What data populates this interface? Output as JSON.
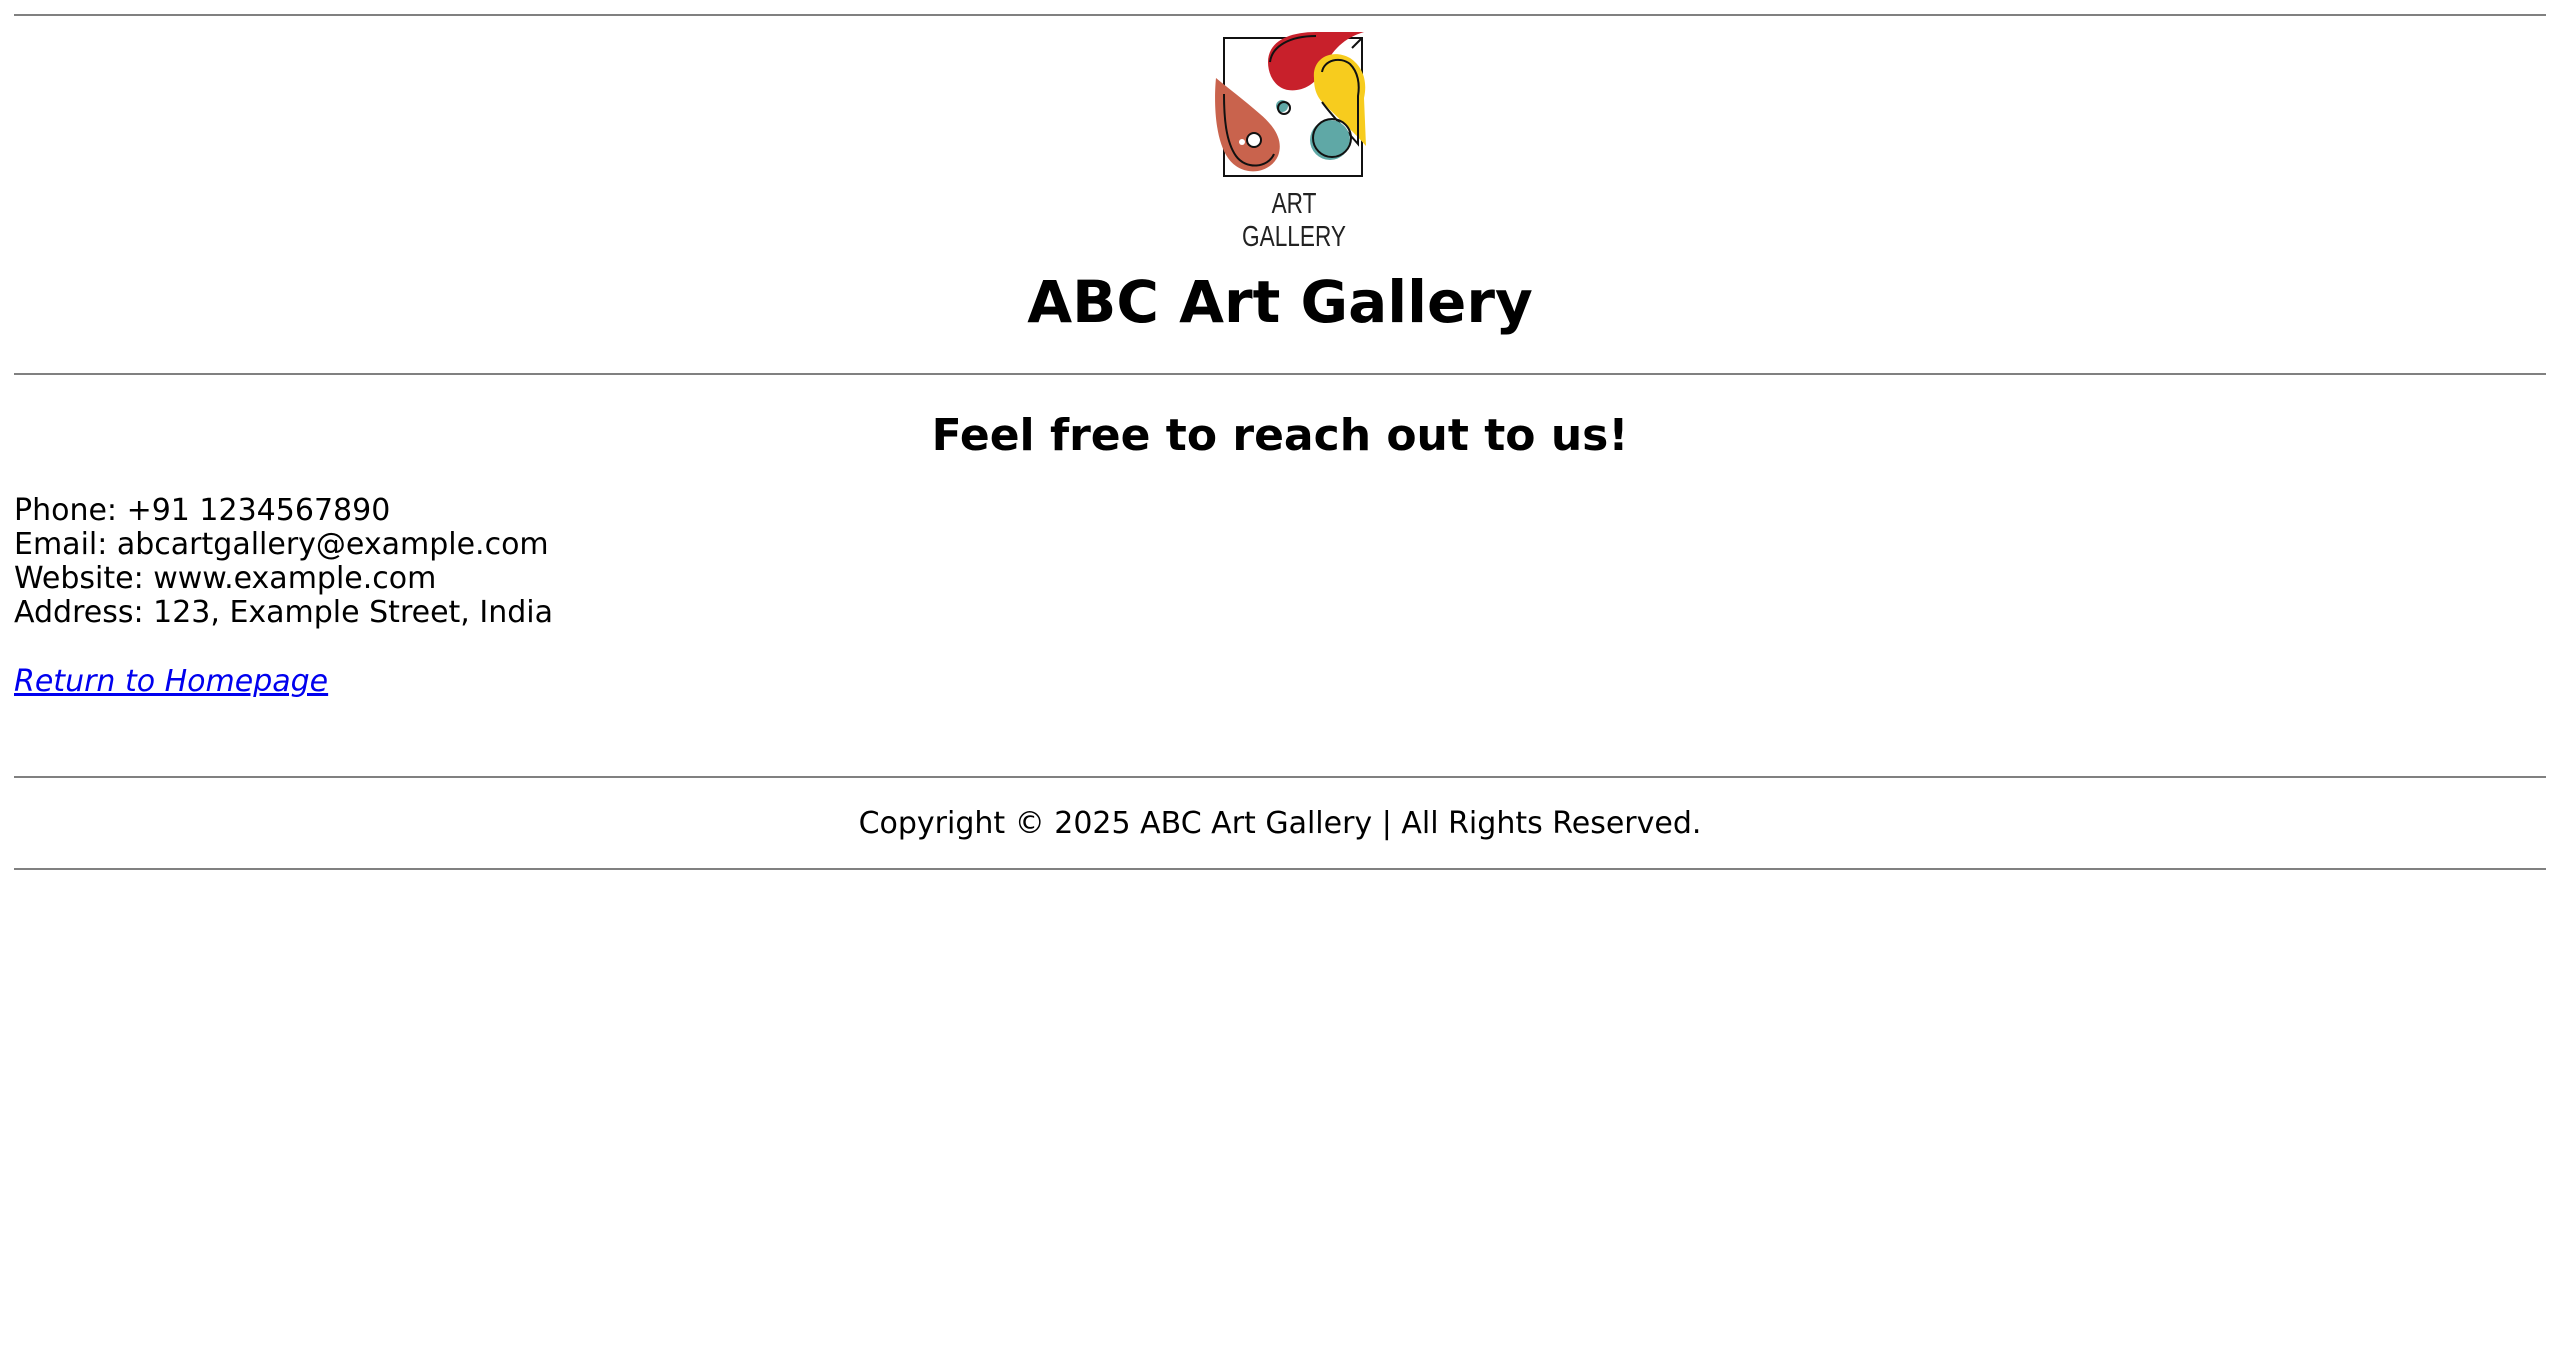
{
  "header": {
    "logo_caption": "ART GALLERY",
    "title": "ABC Art Gallery"
  },
  "contact": {
    "heading": "Feel free to reach out to us!",
    "phone": "Phone: +91 1234567890",
    "email": "Email: abcartgallery@example.com",
    "website": "Website: www.example.com",
    "address": "Address: 123, Example Street, India"
  },
  "navigation": {
    "return_link": "Return to Homepage"
  },
  "footer": {
    "copyright": "Copyright © 2025 ABC Art Gallery | All Rights Reserved."
  },
  "colors": {
    "link": "#0000ee",
    "rule": "#808080",
    "logo_red": "#c8202b",
    "logo_yellow": "#f7cc1e",
    "logo_terracotta": "#c9634d",
    "logo_teal": "#5fa8a6"
  },
  "icons": {
    "logo": "art-gallery-logo-icon"
  }
}
